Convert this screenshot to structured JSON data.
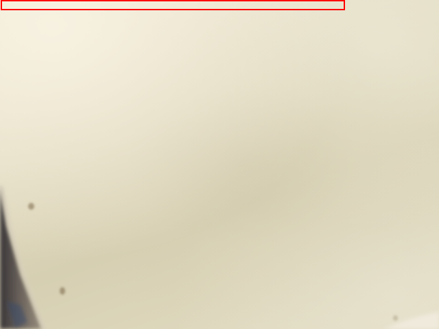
{
  "image": {
    "kind": "blurred close-up photo of a pale cream surface",
    "surface_color": "#e3dcc2",
    "edge_color": "#3a3438"
  },
  "annotation": {
    "shape": "rectangle outline",
    "color": "#ff0000"
  }
}
